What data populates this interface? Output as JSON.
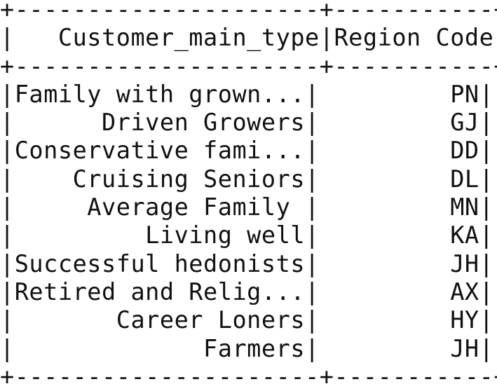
{
  "table": {
    "top_border": "+---------------------+-----------+",
    "header_line": "|   Customer_main_type|Region Code|",
    "header_border": "+---------------------+-----------+",
    "rows": [
      "|Family with grown...|         PN|",
      "|      Driven Growers|         GJ|",
      "|Conservative fami...|         DD|",
      "|    Cruising Seniors|         DL|",
      "|     Average Family |         MN|",
      "|         Living well|         KA|",
      "|Successful hedonists|         JH|",
      "|Retired and Relig...|         AX|",
      "|       Career Loners|         HY|",
      "|             Farmers|         JH|"
    ],
    "bottom_border": "+---------------------+-----------+"
  }
}
